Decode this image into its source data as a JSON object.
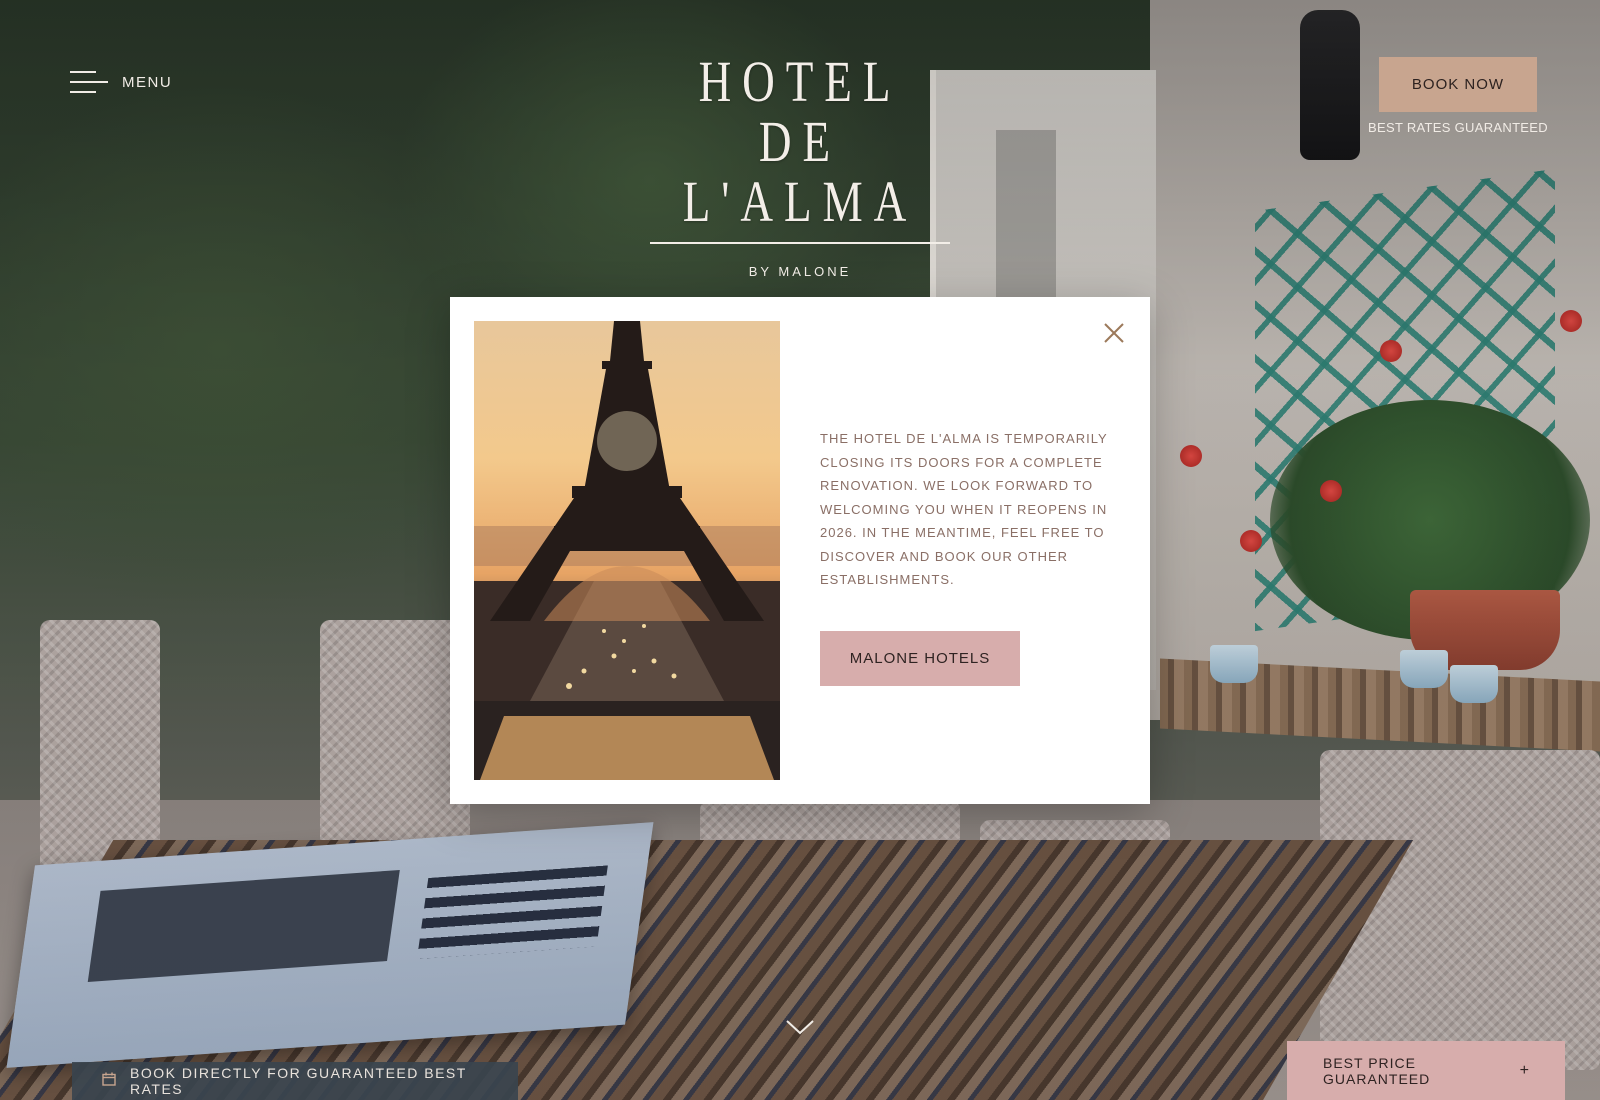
{
  "header": {
    "menu_label": "MENU",
    "logo_line1": "HOTEL",
    "logo_line2": "DE L'ALMA",
    "logo_sub": "BY MALONE",
    "book_now_label": "BOOK NOW",
    "best_rates_label": "BEST RATES GUARANTEED"
  },
  "modal": {
    "message": "THE HOTEL DE L'ALMA IS TEMPORARILY CLOSING ITS DOORS FOR A COMPLETE RENOVATION. WE LOOK FORWARD TO WELCOMING YOU WHEN IT REOPENS IN 2026. IN THE MEANTIME, FEEL FREE TO DISCOVER AND BOOK OUR OTHER ESTABLISHMENTS.",
    "button_label": "MALONE HOTELS",
    "close_icon": "close-icon",
    "photo_subject": "eiffel-tower-sunset"
  },
  "footer": {
    "book_direct_label": "BOOK DIRECTLY FOR GUARANTEED BEST RATES",
    "book_direct_icon": "calendar-icon",
    "best_price_label": "BEST PRICE GUARANTEED",
    "best_price_icon": "+",
    "scroll_icon": "chevron-down-icon"
  },
  "colors": {
    "accent_tan": "#c8a58f",
    "accent_pink": "#d7adac",
    "modal_text": "#8a6f66",
    "close_icon": "#9c7a5b"
  }
}
